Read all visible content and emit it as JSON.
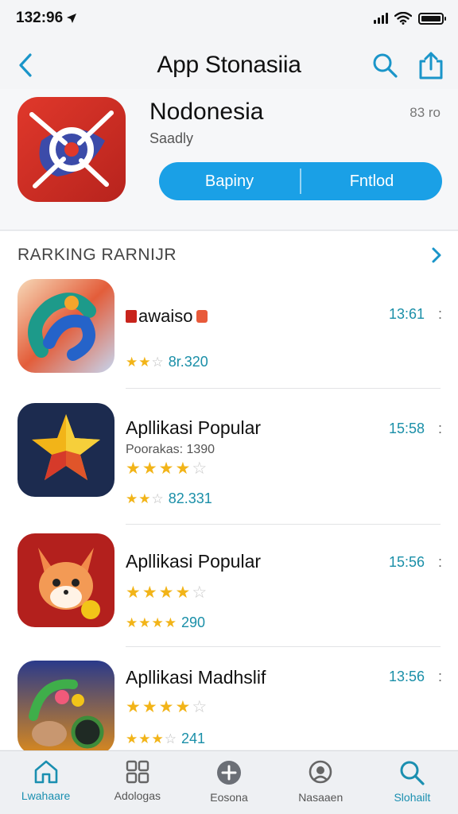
{
  "status": {
    "time": "132:96"
  },
  "nav": {
    "title": "App Stonasiia"
  },
  "featured": {
    "name": "Nodonesia",
    "subtitle": "Saadly",
    "meta": "83 ro",
    "button_primary": "Bapiny",
    "button_secondary": "Fntlod"
  },
  "section": {
    "title": "RARKING RARNIJR"
  },
  "apps": [
    {
      "title": "awaiso",
      "subtitle": "",
      "time": "13:61",
      "more": ":",
      "stars": 0,
      "mini_stars": 2,
      "count": "8r.320"
    },
    {
      "title": "Apllikasi Popular",
      "subtitle": "Poorakas: 1390",
      "time": "15:58",
      "more": ":",
      "stars": 4,
      "mini_stars": 2,
      "count": "82.331"
    },
    {
      "title": "Apllikasi Popular",
      "subtitle": "",
      "time": "15:56",
      "more": ":",
      "stars": 4,
      "mini_stars": 4,
      "count": "290"
    },
    {
      "title": "Apllikasi Madhslif",
      "subtitle": "",
      "time": "13:56",
      "more": ":",
      "stars": 4,
      "mini_stars": 3,
      "count": "241"
    }
  ],
  "tabs": [
    {
      "label": "Lwahaare",
      "icon": "home-icon",
      "active": true
    },
    {
      "label": "Adologas",
      "icon": "grid-icon",
      "active": false
    },
    {
      "label": "Eosona",
      "icon": "plus-circle-icon",
      "active": false
    },
    {
      "label": "Nasaaen",
      "icon": "profile-icon",
      "active": false
    },
    {
      "label": "Slohailt",
      "icon": "search-icon",
      "active": true
    }
  ],
  "colors": {
    "accent": "#1aa0e6",
    "link": "#1a8fb0",
    "star": "#f2b418"
  }
}
